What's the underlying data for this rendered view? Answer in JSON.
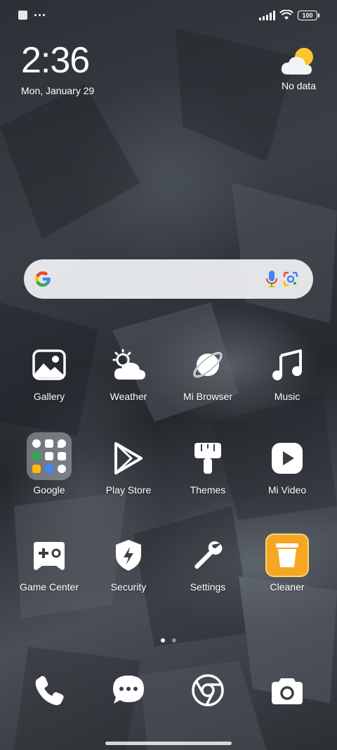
{
  "status_bar": {
    "battery": "100"
  },
  "clock_widget": {
    "time": "2:36",
    "date": "Mon, January 29"
  },
  "weather_widget": {
    "text": "No data"
  },
  "search": {
    "aria": "Google search"
  },
  "apps": {
    "row1": [
      {
        "label": "Gallery",
        "icon": "gallery-icon"
      },
      {
        "label": "Weather",
        "icon": "weather-icon"
      },
      {
        "label": "Mi Browser",
        "icon": "browser-icon"
      },
      {
        "label": "Music",
        "icon": "music-icon"
      }
    ],
    "row2": [
      {
        "label": "Google",
        "icon": "google-folder"
      },
      {
        "label": "Play Store",
        "icon": "play-store-icon"
      },
      {
        "label": "Themes",
        "icon": "themes-icon"
      },
      {
        "label": "Mi Video",
        "icon": "video-icon"
      }
    ],
    "row3": [
      {
        "label": "Game Center",
        "icon": "game-icon"
      },
      {
        "label": "Security",
        "icon": "security-icon"
      },
      {
        "label": "Settings",
        "icon": "settings-icon"
      },
      {
        "label": "Cleaner",
        "icon": "cleaner-icon"
      }
    ]
  },
  "dock": [
    {
      "icon": "phone-icon"
    },
    {
      "icon": "messages-icon"
    },
    {
      "icon": "chrome-icon"
    },
    {
      "icon": "camera-icon"
    }
  ],
  "pages": {
    "count": 2,
    "active": 1
  },
  "colors": {
    "google_blue": "#4285F4",
    "google_red": "#EA4335",
    "google_yellow": "#FBBC05",
    "google_green": "#34A853",
    "cleaner_orange": "#F5A623"
  }
}
